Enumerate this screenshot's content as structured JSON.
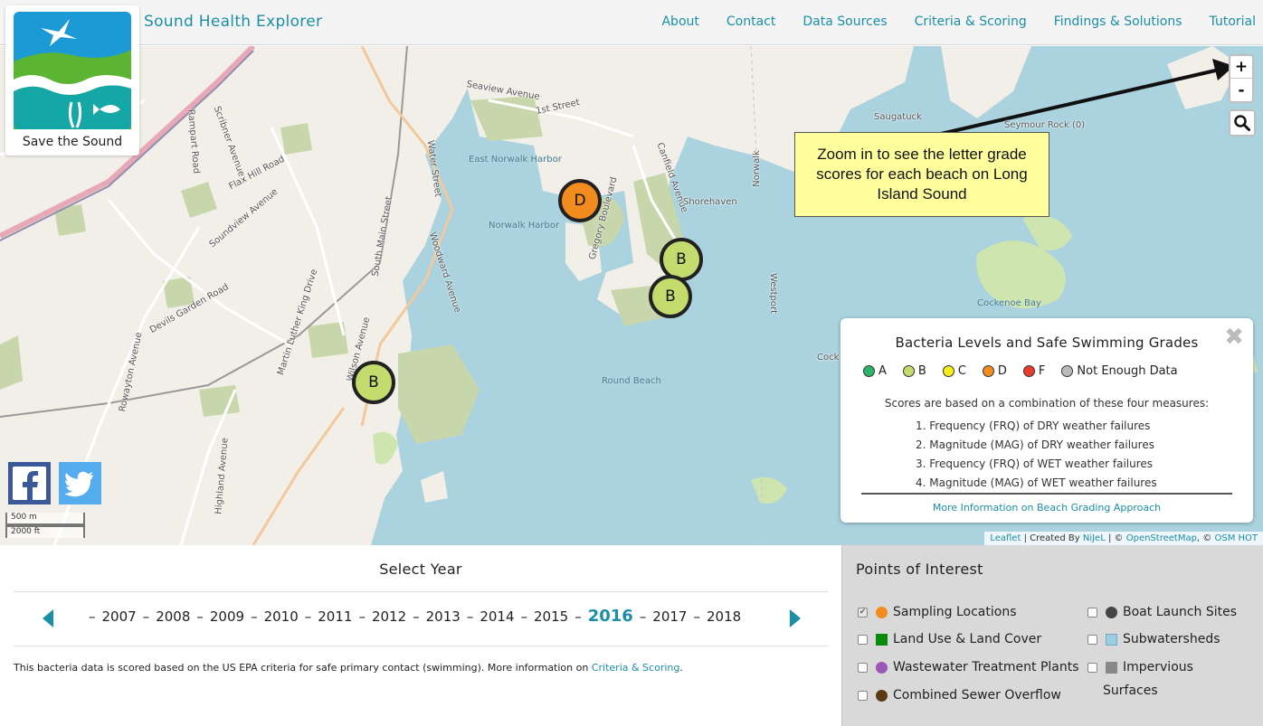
{
  "app": {
    "title": "Sound Health Explorer",
    "logo_text": "Save the Sound"
  },
  "nav": [
    {
      "label": "About"
    },
    {
      "label": "Contact"
    },
    {
      "label": "Data Sources"
    },
    {
      "label": "Criteria & Scoring"
    },
    {
      "label": "Findings & Solutions"
    },
    {
      "label": "Tutorial"
    }
  ],
  "map": {
    "labels": [
      {
        "text": "Seaview Avenue"
      },
      {
        "text": "1st Street"
      },
      {
        "text": "Saugatuck"
      },
      {
        "text": "Seymour Rock (0)"
      },
      {
        "text": "East Norwalk Harbor"
      },
      {
        "text": "Norwalk Harbor"
      },
      {
        "text": "Shorehaven"
      },
      {
        "text": "Canfield Avenue"
      },
      {
        "text": "Gregory Boulevard"
      },
      {
        "text": "Norwalk"
      },
      {
        "text": "Westport"
      },
      {
        "text": "Cockenoe Bay"
      },
      {
        "text": "Round Beach"
      },
      {
        "text": "Water Street"
      },
      {
        "text": "South Main Street"
      },
      {
        "text": "Woodward Avenue"
      },
      {
        "text": "Flax Hill Road"
      },
      {
        "text": "Soundview Avenue"
      },
      {
        "text": "Devils Garden Road"
      },
      {
        "text": "Highland Avenue"
      },
      {
        "text": "Martin Luther King Drive"
      },
      {
        "text": "Wilson Avenue"
      },
      {
        "text": "Rowayton Avenue"
      },
      {
        "text": "Rampart Road"
      },
      {
        "text": "Scribner Avenue"
      },
      {
        "text": "Cock"
      }
    ],
    "markers": [
      {
        "grade": "D",
        "color": "#f28c1e"
      },
      {
        "grade": "B",
        "color": "#c4dc6e"
      },
      {
        "grade": "B",
        "color": "#c4dc6e"
      },
      {
        "grade": "B",
        "color": "#c4dc6e"
      }
    ],
    "zoom_in": "+",
    "zoom_out": "-",
    "search_icon": "search-icon",
    "tooltip": "Zoom in to see the letter grade scores for each beach on Long Island Sound",
    "scale": {
      "metric": "500 m",
      "imperial": "2000 ft"
    },
    "attribution": {
      "leaflet": "Leaflet",
      "created_by": "| Created By",
      "nijel": "NiJeL",
      "copy1": "| ©",
      "osm": "OpenStreetMap",
      "copy2": ", ©",
      "osm_hot": "OSM HOT"
    }
  },
  "legend": {
    "title": "Bacteria Levels and Safe Swimming Grades",
    "close": "✖",
    "grades": [
      {
        "label": "A",
        "color": "#2db36a"
      },
      {
        "label": "B",
        "color": "#c4dc6e"
      },
      {
        "label": "C",
        "color": "#f5ed1a"
      },
      {
        "label": "D",
        "color": "#f28c1e"
      },
      {
        "label": "F",
        "color": "#e83a2e"
      },
      {
        "label": "Not Enough Data",
        "color": "#bbbbbb"
      }
    ],
    "intro": "Scores are based on a combination of these four measures:",
    "measures": [
      "1. Frequency (FRQ) of DRY weather failures",
      "2. Magnitude (MAG) of DRY weather failures",
      "3. Frequency (FRQ) of WET weather failures",
      "4. Magnitude (MAG) of WET weather failures"
    ],
    "link": "More Information on Beach Grading Approach"
  },
  "social": {
    "facebook": "f",
    "twitter": "twitter-bird"
  },
  "years": {
    "title": "Select Year",
    "list": [
      "2007",
      "2008",
      "2009",
      "2010",
      "2011",
      "2012",
      "2013",
      "2014",
      "2015",
      "2016",
      "2017",
      "2018"
    ],
    "selected": "2016",
    "separator": "–",
    "note_text": "This bacteria data is scored based on the US EPA criteria for safe primary contact (swimming). More information on",
    "note_link": "Criteria & Scoring",
    "note_end": "."
  },
  "poi": {
    "title": "Points of Interest",
    "items": [
      {
        "label": "Sampling Locations",
        "checked": true,
        "color": "#f28c1e",
        "shape": "circle"
      },
      {
        "label": "Land Use & Land Cover",
        "checked": false,
        "color": "#0a8a0a",
        "shape": "square"
      },
      {
        "label": "Wastewater Treatment Plants",
        "checked": false,
        "color": "#9b59b6",
        "shape": "circle"
      },
      {
        "label": "Combined Sewer Overflow",
        "checked": false,
        "color": "#5a3a10",
        "shape": "circle"
      },
      {
        "label": "Boat Launch Sites",
        "checked": false,
        "color": "#444444",
        "shape": "circle"
      },
      {
        "label": "Subwatersheds",
        "checked": false,
        "color": "#9ccde0",
        "shape": "square"
      },
      {
        "label": "Impervious",
        "checked": false,
        "color": "#888888",
        "shape": "square"
      },
      {
        "label": "Surfaces"
      }
    ]
  }
}
